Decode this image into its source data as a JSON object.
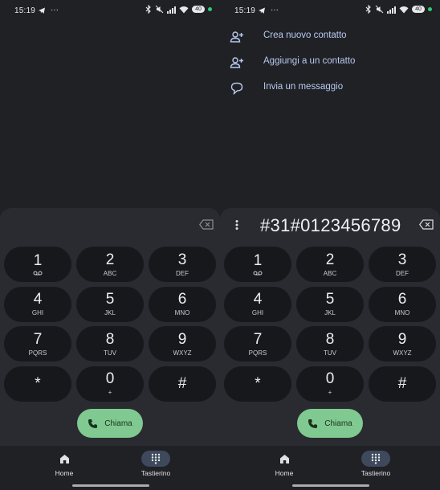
{
  "status_bar": {
    "time": "15:19",
    "dots": "···",
    "battery": "40"
  },
  "left_panel": {
    "dialer": {
      "number": ""
    },
    "keys": [
      {
        "digit": "1",
        "letters": ""
      },
      {
        "digit": "2",
        "letters": "ABC"
      },
      {
        "digit": "3",
        "letters": "DEF"
      },
      {
        "digit": "4",
        "letters": "GHI"
      },
      {
        "digit": "5",
        "letters": "JKL"
      },
      {
        "digit": "6",
        "letters": "MNO"
      },
      {
        "digit": "7",
        "letters": "PQRS"
      },
      {
        "digit": "8",
        "letters": "TUV"
      },
      {
        "digit": "9",
        "letters": "WXYZ"
      },
      {
        "digit": "*",
        "letters": ""
      },
      {
        "digit": "0",
        "letters": "+"
      },
      {
        "digit": "#",
        "letters": ""
      }
    ],
    "call_label": "Chiama",
    "nav": {
      "home": "Home",
      "keypad": "Tastierino"
    }
  },
  "right_panel": {
    "menu": [
      {
        "label": "Crea nuovo contatto",
        "icon": "add-person-icon"
      },
      {
        "label": "Aggiungi a un contatto",
        "icon": "add-person-icon"
      },
      {
        "label": "Invia un messaggio",
        "icon": "message-icon"
      }
    ],
    "dialer": {
      "number": "#31#0123456789"
    },
    "keys": [
      {
        "digit": "1",
        "letters": ""
      },
      {
        "digit": "2",
        "letters": "ABC"
      },
      {
        "digit": "3",
        "letters": "DEF"
      },
      {
        "digit": "4",
        "letters": "GHI"
      },
      {
        "digit": "5",
        "letters": "JKL"
      },
      {
        "digit": "6",
        "letters": "MNO"
      },
      {
        "digit": "7",
        "letters": "PQRS"
      },
      {
        "digit": "8",
        "letters": "TUV"
      },
      {
        "digit": "9",
        "letters": "WXYZ"
      },
      {
        "digit": "*",
        "letters": ""
      },
      {
        "digit": "0",
        "letters": "+"
      },
      {
        "digit": "#",
        "letters": ""
      }
    ],
    "call_label": "Chiama",
    "nav": {
      "home": "Home",
      "keypad": "Tastierino"
    }
  },
  "colors": {
    "accent_call": "#80c990",
    "link": "#b9c9ef",
    "background": "#1f2125",
    "key_bg": "#16181c"
  }
}
